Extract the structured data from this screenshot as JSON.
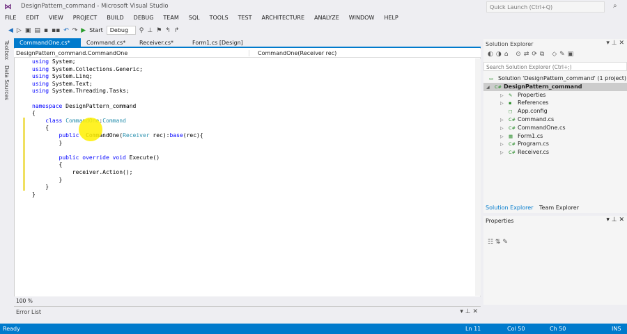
{
  "window": {
    "title": "DesignPattern_command - Microsoft Visual Studio",
    "quick_launch": "Quick Launch (Ctrl+Q)"
  },
  "menu": [
    "FILE",
    "EDIT",
    "VIEW",
    "PROJECT",
    "BUILD",
    "DEBUG",
    "TEAM",
    "SQL",
    "TOOLS",
    "TEST",
    "ARCHITECTURE",
    "ANALYZE",
    "WINDOW",
    "HELP"
  ],
  "toolbar": {
    "start": "Start",
    "config": "Debug"
  },
  "left_strip": {
    "toolbox": "Toolbox",
    "data_sources": "Data Sources"
  },
  "tabs": [
    {
      "label": "CommandOne.cs*",
      "active": true
    },
    {
      "label": "Command.cs*"
    },
    {
      "label": "Receiver.cs*"
    },
    {
      "label": "Form1.cs [Design]"
    }
  ],
  "navbar": {
    "type": "DesignPattern_command.CommandOne",
    "member": "CommandOne(Receiver rec)"
  },
  "code": [
    [
      [
        "kw",
        "using"
      ],
      [
        "pl",
        " System;"
      ]
    ],
    [
      [
        "kw",
        "using"
      ],
      [
        "pl",
        " System.Collections.Generic;"
      ]
    ],
    [
      [
        "kw",
        "using"
      ],
      [
        "pl",
        " System.Linq;"
      ]
    ],
    [
      [
        "kw",
        "using"
      ],
      [
        "pl",
        " System.Text;"
      ]
    ],
    [
      [
        "kw",
        "using"
      ],
      [
        "pl",
        " System.Threading.Tasks;"
      ]
    ],
    [],
    [
      [
        "kw",
        "namespace"
      ],
      [
        "pl",
        " DesignPattern_command"
      ]
    ],
    [
      [
        "pl",
        "{"
      ]
    ],
    [
      [
        "pl",
        "    "
      ],
      [
        "kw",
        "class"
      ],
      [
        "pl",
        " "
      ],
      [
        "ty",
        "CommandOne"
      ],
      [
        "pl",
        ":"
      ],
      [
        "ty",
        "Command"
      ]
    ],
    [
      [
        "pl",
        "    {"
      ]
    ],
    [
      [
        "pl",
        "        "
      ],
      [
        "kw",
        "public"
      ],
      [
        "pl",
        "  CommandOne("
      ],
      [
        "ty",
        "Receiver"
      ],
      [
        "pl",
        " rec):"
      ],
      [
        "kw",
        "base"
      ],
      [
        "pl",
        "(rec){"
      ]
    ],
    [
      [
        "pl",
        "        }"
      ]
    ],
    [],
    [
      [
        "pl",
        "        "
      ],
      [
        "kw",
        "public override void"
      ],
      [
        "pl",
        " Execute()"
      ]
    ],
    [
      [
        "pl",
        "        {"
      ]
    ],
    [
      [
        "pl",
        "            receiver.Action();"
      ]
    ],
    [
      [
        "pl",
        "        }"
      ]
    ],
    [
      [
        "pl",
        "    }"
      ]
    ],
    [
      [
        "pl",
        "}"
      ]
    ]
  ],
  "zoom": "100 %",
  "error_list": {
    "title": "Error List"
  },
  "status": {
    "ready": "Ready",
    "ln": "Ln 11",
    "col": "Col 50",
    "ch": "Ch 50",
    "mode": "INS"
  },
  "solution_explorer": {
    "title": "Solution Explorer",
    "search_placeholder": "Search Solution Explorer (Ctrl+;)",
    "items": [
      {
        "label": "Solution 'DesignPattern_command' (1 project)",
        "icon": "solution-icon",
        "depth": 0
      },
      {
        "label": "DesignPattern_command",
        "icon": "csharp-project-icon",
        "depth": 1,
        "selected": true
      },
      {
        "label": "Properties",
        "icon": "wrench-icon",
        "depth": 2,
        "expand": true
      },
      {
        "label": "References",
        "icon": "references-icon",
        "depth": 2,
        "expand": true
      },
      {
        "label": "App.config",
        "icon": "config-icon",
        "depth": 2
      },
      {
        "label": "Command.cs",
        "icon": "csharp-file-icon",
        "depth": 2,
        "expand": true
      },
      {
        "label": "CommandOne.cs",
        "icon": "csharp-file-icon",
        "depth": 2,
        "expand": true
      },
      {
        "label": "Form1.cs",
        "icon": "form-icon",
        "depth": 2,
        "expand": true
      },
      {
        "label": "Program.cs",
        "icon": "csharp-file-icon",
        "depth": 2,
        "expand": true
      },
      {
        "label": "Receiver.cs",
        "icon": "csharp-file-icon",
        "depth": 2,
        "expand": true
      }
    ],
    "tab_solution": "Solution Explorer",
    "tab_team": "Team Explorer"
  },
  "properties": {
    "title": "Properties"
  },
  "colors": {
    "accent": "#007acc",
    "keyword": "#0000ff",
    "type": "#2b91af"
  }
}
